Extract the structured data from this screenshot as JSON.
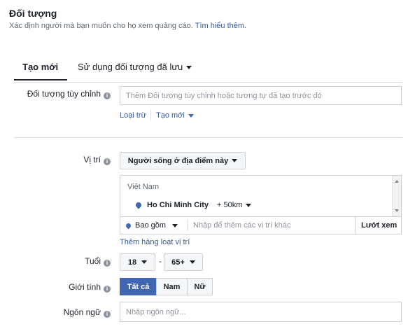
{
  "header": {
    "title": "Đối tượng",
    "description": "Xác định người mà bạn muốn cho họ xem quảng cáo.",
    "learn_more": "Tìm hiểu thêm."
  },
  "tabs": [
    {
      "label": "Tạo mới",
      "active": true
    },
    {
      "label": "Sử dụng đối tượng đã lưu",
      "active": false
    }
  ],
  "custom_audience": {
    "label": "Đối tượng tùy chỉnh",
    "placeholder": "Thêm Đối tượng tùy chỉnh hoặc tương tự đã tạo trước đó",
    "exclude_link": "Loại trừ",
    "create_new_link": "Tạo mới"
  },
  "location": {
    "label": "Vị trí",
    "type_dropdown": "Người sống ở địa điểm này",
    "country": "Việt Nam",
    "city": "Ho Chi Minh City",
    "radius": "+ 50km",
    "include_dropdown": "Bao gồm",
    "search_placeholder": "Nhập để thêm các vị trí khác",
    "browse_button": "Lướt xem",
    "bulk_add_link": "Thêm hàng loạt vị trí"
  },
  "age": {
    "label": "Tuổi",
    "min": "18",
    "separator": "-",
    "max": "65+"
  },
  "gender": {
    "label": "Giới tính",
    "options": [
      "Tất cả",
      "Nam",
      "Nữ"
    ],
    "selected": "Tất cả"
  },
  "language": {
    "label": "Ngôn ngữ",
    "placeholder": "Nhập ngôn ngữ..."
  },
  "colors": {
    "accent": "#4267b2",
    "link": "#365899"
  }
}
